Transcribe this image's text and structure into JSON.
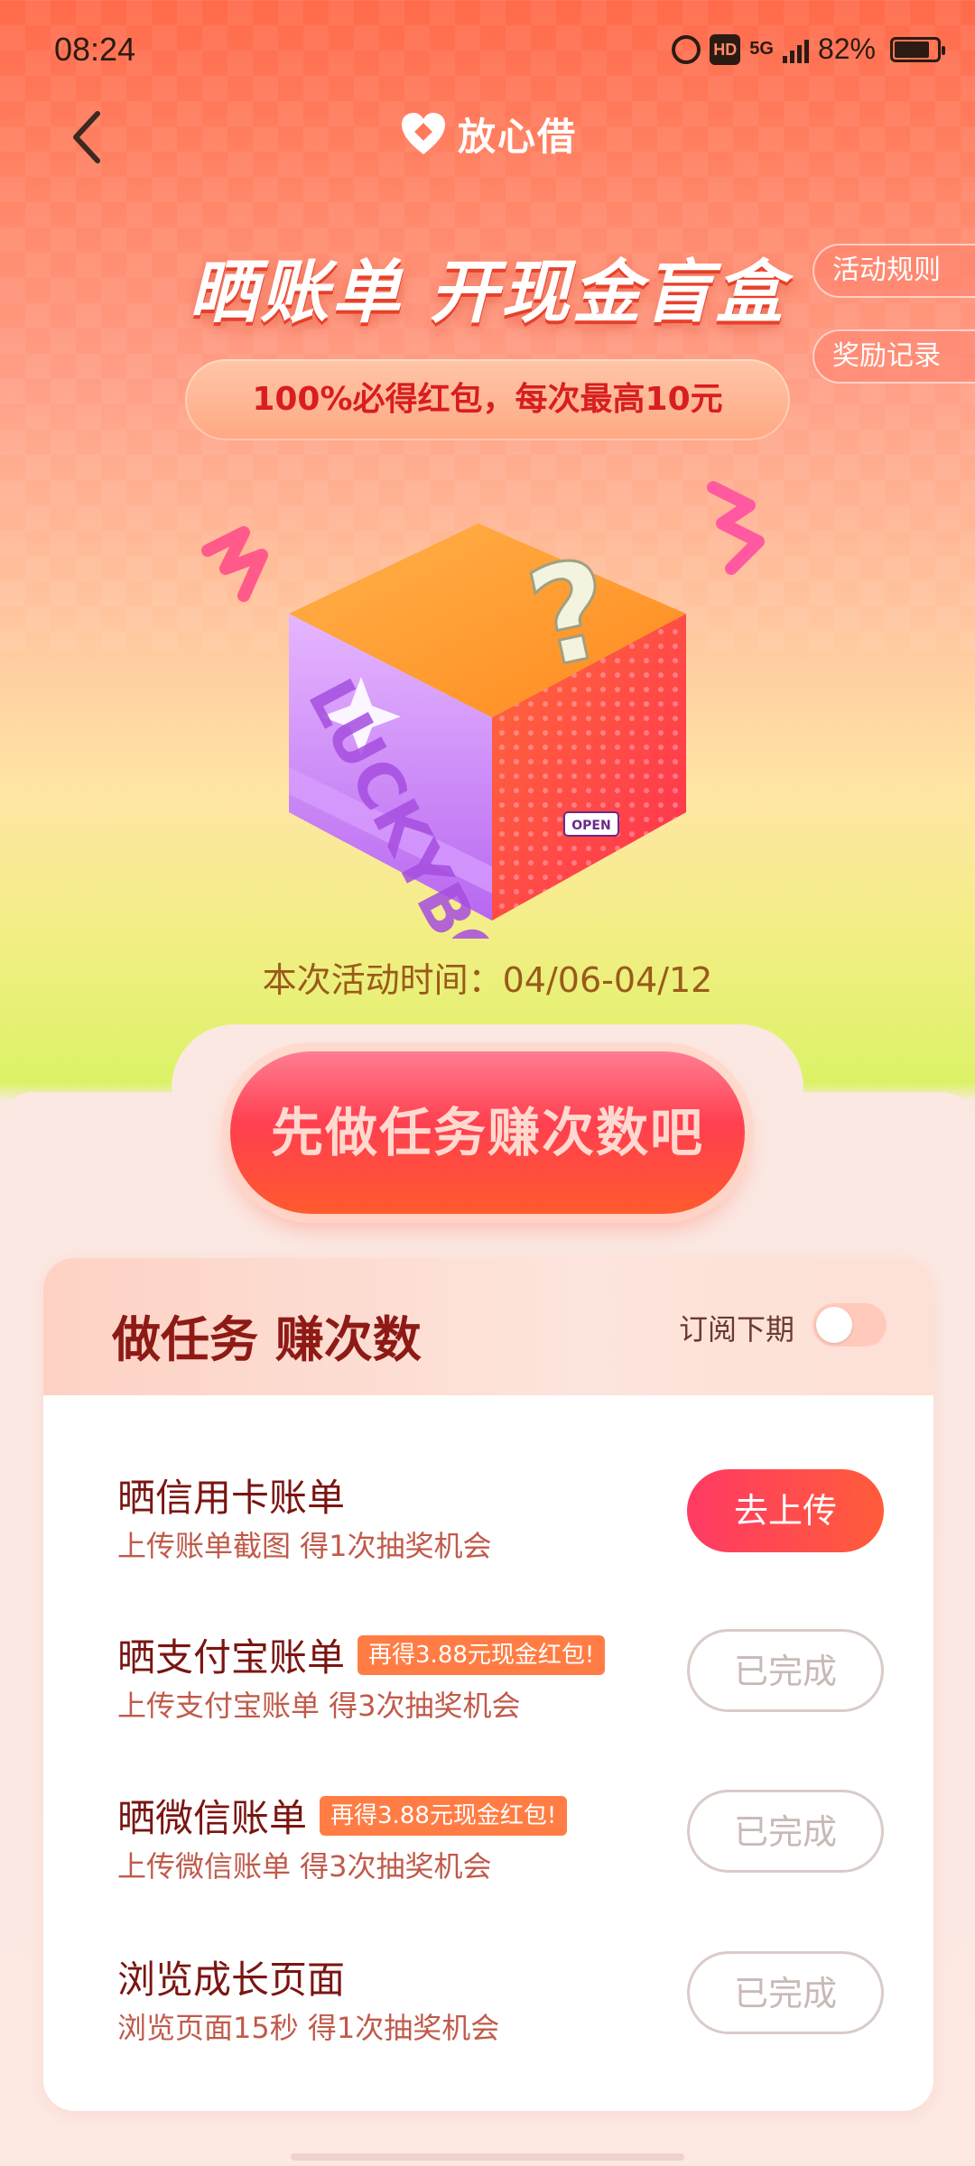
{
  "status_bar": {
    "time": "08:24",
    "hd_label": "HD",
    "network": "5G",
    "battery_text": "82%",
    "battery_level": 0.82
  },
  "header": {
    "brand_name": "放心借"
  },
  "side_buttons": {
    "rules": "活动规则",
    "records": "奖励记录"
  },
  "hero": {
    "title": "晒账单 开现金盲盒",
    "subtitle": "100%必得红包，每次最高10元",
    "box_brand": "LUCKYBOX.",
    "box_open_label": "OPEN",
    "activity_time": "本次活动时间：04/06-04/12"
  },
  "cta": {
    "label": "先做任务赚次数吧"
  },
  "task_card": {
    "title": "做任务 赚次数",
    "subscribe_label": "订阅下期",
    "subscribe_on": false,
    "tasks": [
      {
        "title": "晒信用卡账单",
        "badge": "",
        "desc": "上传账单截图 得1次抽奖机会",
        "button": "去上传",
        "state": "primary"
      },
      {
        "title": "晒支付宝账单",
        "badge": "再得3.88元现金红包!",
        "desc": "上传支付宝账单 得3次抽奖机会",
        "button": "已完成",
        "state": "done"
      },
      {
        "title": "晒微信账单",
        "badge": "再得3.88元现金红包!",
        "desc": "上传微信账单 得3次抽奖机会",
        "button": "已完成",
        "state": "done"
      },
      {
        "title": "浏览成长页面",
        "badge": "",
        "desc": "浏览页面15秒 得1次抽奖机会",
        "button": "已完成",
        "state": "done"
      }
    ]
  },
  "colors": {
    "accent": "#ff3a64",
    "title_dark": "#8e1a16",
    "badge": "#ff7d45"
  }
}
